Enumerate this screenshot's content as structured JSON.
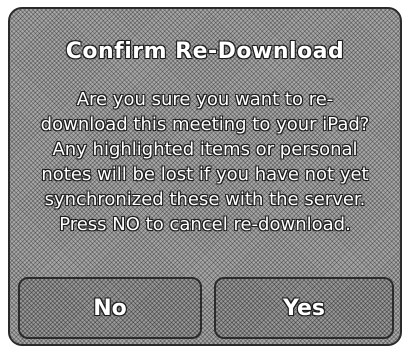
{
  "dialog": {
    "title": "Confirm Re-Download",
    "message_lines": [
      "Are you sure you want to re-",
      "download this meeting to your iPad?",
      "Any highlighted items or personal",
      "notes will be lost if you have not yet",
      "synchronized these with the server.",
      "Press NO to cancel re-download."
    ],
    "no_label": "No",
    "yes_label": "Yes"
  }
}
